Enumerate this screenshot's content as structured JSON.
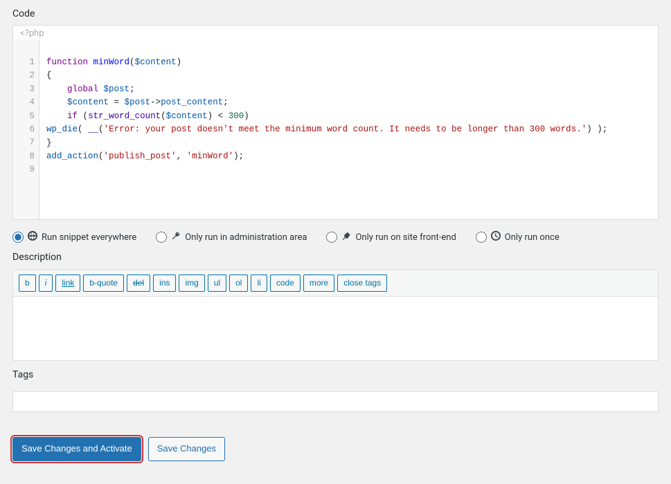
{
  "sections": {
    "code": "Code",
    "description": "Description",
    "tags": "Tags"
  },
  "editor": {
    "placeholder": "<?php",
    "lines": [
      "1",
      "2",
      "3",
      "4",
      "5",
      "6",
      "7",
      "8",
      "9"
    ],
    "tokens": [
      [
        [
          "keyword",
          "function"
        ],
        [
          "plain",
          " "
        ],
        [
          "def",
          "minWord"
        ],
        [
          "punc",
          "("
        ],
        [
          "var",
          "$content"
        ],
        [
          "punc",
          ")"
        ]
      ],
      [
        [
          "punc",
          "{"
        ]
      ],
      [
        [
          "plain",
          "    "
        ],
        [
          "keyword",
          "global"
        ],
        [
          "plain",
          " "
        ],
        [
          "var",
          "$post"
        ],
        [
          "punc",
          ";"
        ]
      ],
      [
        [
          "plain",
          "    "
        ],
        [
          "var",
          "$content"
        ],
        [
          "plain",
          " "
        ],
        [
          "op",
          "="
        ],
        [
          "plain",
          " "
        ],
        [
          "var",
          "$post"
        ],
        [
          "op",
          "->"
        ],
        [
          "var2",
          "post_content"
        ],
        [
          "punc",
          ";"
        ]
      ],
      [
        [
          "plain",
          "    "
        ],
        [
          "keyword",
          "if"
        ],
        [
          "plain",
          " "
        ],
        [
          "punc",
          "("
        ],
        [
          "builtin",
          "str_word_count"
        ],
        [
          "punc",
          "("
        ],
        [
          "var",
          "$content"
        ],
        [
          "punc",
          ")"
        ],
        [
          "plain",
          " "
        ],
        [
          "op",
          "<"
        ],
        [
          "plain",
          " "
        ],
        [
          "num",
          "300"
        ],
        [
          "punc",
          ")"
        ]
      ],
      [
        [
          "func",
          "wp_die"
        ],
        [
          "punc",
          "("
        ],
        [
          "plain",
          " "
        ],
        [
          "builtin",
          "__"
        ],
        [
          "punc",
          "("
        ],
        [
          "str",
          "'Error: your post doesn't meet the minimum word count. It needs to be longer than 300 words.'"
        ],
        [
          "punc",
          ")"
        ],
        [
          "plain",
          " "
        ],
        [
          "punc",
          ")"
        ],
        [
          "punc",
          ";"
        ]
      ],
      [
        [
          "punc",
          "}"
        ]
      ],
      [
        [
          "func",
          "add_action"
        ],
        [
          "punc",
          "("
        ],
        [
          "str",
          "'publish_post'"
        ],
        [
          "punc",
          ","
        ],
        [
          "plain",
          " "
        ],
        [
          "str",
          "'minWord'"
        ],
        [
          "punc",
          ")"
        ],
        [
          "punc",
          ";"
        ]
      ],
      []
    ]
  },
  "run_options": {
    "selected": 0,
    "items": [
      {
        "label": "Run snippet everywhere",
        "icon": "globe"
      },
      {
        "label": "Only run in administration area",
        "icon": "wrench"
      },
      {
        "label": "Only run on site front-end",
        "icon": "pin"
      },
      {
        "label": "Only run once",
        "icon": "clock"
      }
    ]
  },
  "quicktags": [
    {
      "label": "b"
    },
    {
      "label": "i",
      "style": "i"
    },
    {
      "label": "link",
      "style": "u"
    },
    {
      "label": "b-quote"
    },
    {
      "label": "del",
      "style": "s"
    },
    {
      "label": "ins"
    },
    {
      "label": "img"
    },
    {
      "label": "ul"
    },
    {
      "label": "ol"
    },
    {
      "label": "li"
    },
    {
      "label": "code"
    },
    {
      "label": "more"
    },
    {
      "label": "close tags"
    }
  ],
  "description_value": "",
  "tags_value": "",
  "buttons": {
    "primary": "Save Changes and Activate",
    "secondary": "Save Changes"
  }
}
